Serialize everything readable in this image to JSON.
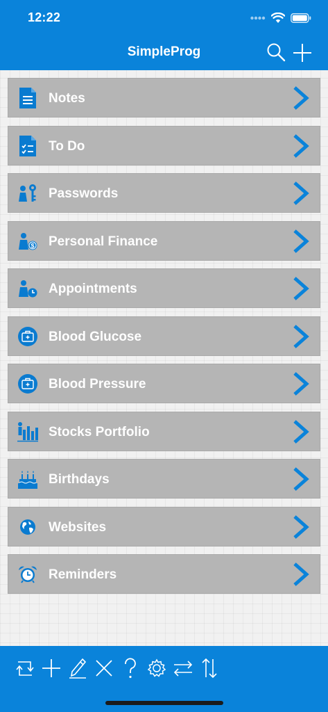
{
  "status_bar": {
    "time": "12:22",
    "icons": [
      "signal-dots-icon",
      "wifi-icon",
      "battery-icon"
    ]
  },
  "header": {
    "title": "SimpleProg",
    "actions": [
      {
        "name": "search-button",
        "icon": "search-icon"
      },
      {
        "name": "add-button",
        "icon": "plus-icon"
      }
    ]
  },
  "colors": {
    "bar_blue": "#0a83da",
    "row_gray": "#b5b5b5",
    "icon_blue": "#0a7bd0",
    "chevron_blue": "#0a83da"
  },
  "menu": {
    "items": [
      {
        "label": "Notes",
        "icon": "notes-document-icon"
      },
      {
        "label": "To Do",
        "icon": "checklist-document-icon"
      },
      {
        "label": "Passwords",
        "icon": "person-key-icon"
      },
      {
        "label": "Personal Finance",
        "icon": "person-dollar-icon"
      },
      {
        "label": "Appointments",
        "icon": "person-clock-icon"
      },
      {
        "label": "Blood Glucose",
        "icon": "medical-kit-icon"
      },
      {
        "label": "Blood Pressure",
        "icon": "medical-kit-icon"
      },
      {
        "label": "Stocks Portfolio",
        "icon": "person-bar-chart-icon"
      },
      {
        "label": "Birthdays",
        "icon": "birthday-cake-icon"
      },
      {
        "label": "Websites",
        "icon": "globe-icon"
      },
      {
        "label": "Reminders",
        "icon": "alarm-clock-icon"
      }
    ],
    "chevron_icon": "chevron-right-icon"
  },
  "toolbar": {
    "tools": [
      {
        "name": "sync-button",
        "icon": "sync-arrows-icon"
      },
      {
        "name": "add-item-button",
        "icon": "plus-icon"
      },
      {
        "name": "edit-button",
        "icon": "pencil-icon"
      },
      {
        "name": "delete-button",
        "icon": "close-x-icon"
      },
      {
        "name": "help-button",
        "icon": "question-mark-icon"
      },
      {
        "name": "settings-button",
        "icon": "gear-icon"
      },
      {
        "name": "transfer-button",
        "icon": "horizontal-arrows-icon"
      },
      {
        "name": "sort-button",
        "icon": "vertical-arrows-icon"
      }
    ]
  }
}
